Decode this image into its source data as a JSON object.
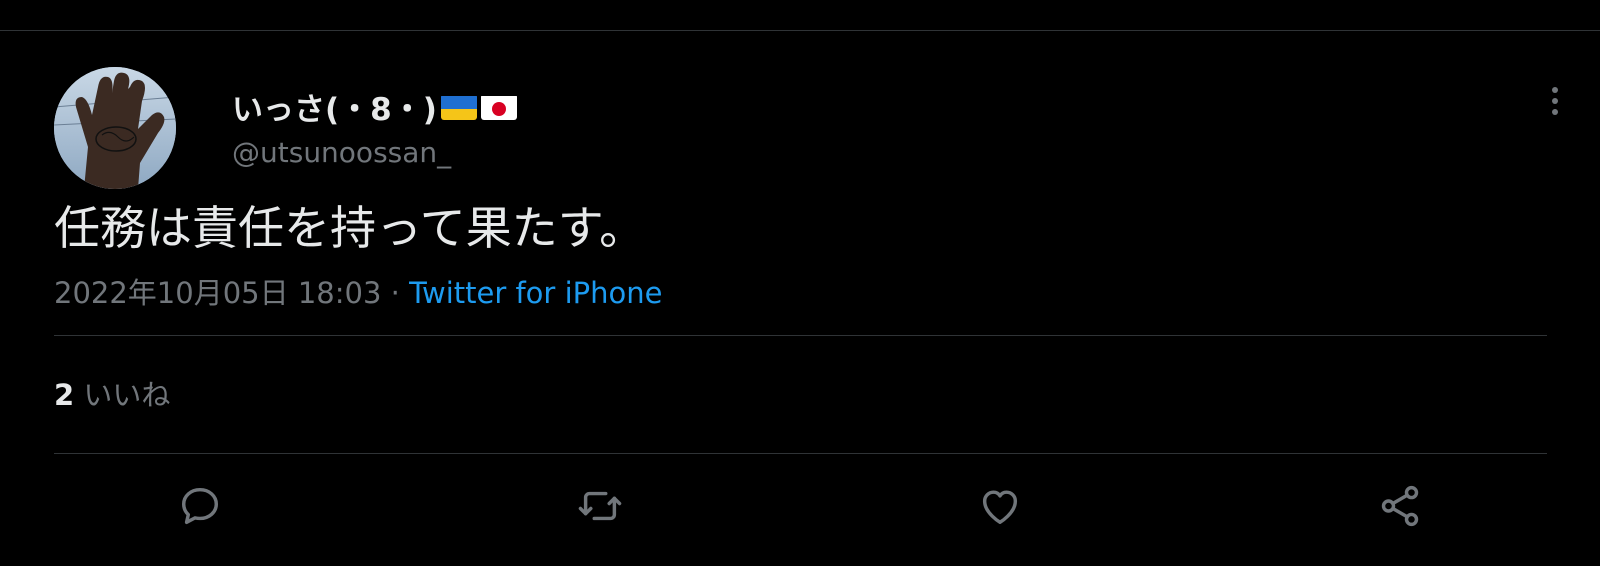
{
  "tweet": {
    "display_name": "いっさ(・8・)",
    "flags": [
      "ukraine-flag",
      "japan-flag"
    ],
    "handle": "@utsunoossan_",
    "text": "任務は責任を持って果たす。",
    "timestamp": "2022年10月05日 18:03",
    "separator": " · ",
    "source": "Twitter for iPhone",
    "like_count": "2",
    "like_label": " いいね"
  },
  "icons": {
    "more": "more-vertical-icon",
    "reply": "reply-icon",
    "retweet": "retweet-icon",
    "like": "heart-icon",
    "share": "share-icon"
  },
  "colors": {
    "background": "#000000",
    "primary_text": "#e7e9ea",
    "secondary_text": "#71767b",
    "link": "#1d9bf0",
    "divider": "#2f3336"
  }
}
